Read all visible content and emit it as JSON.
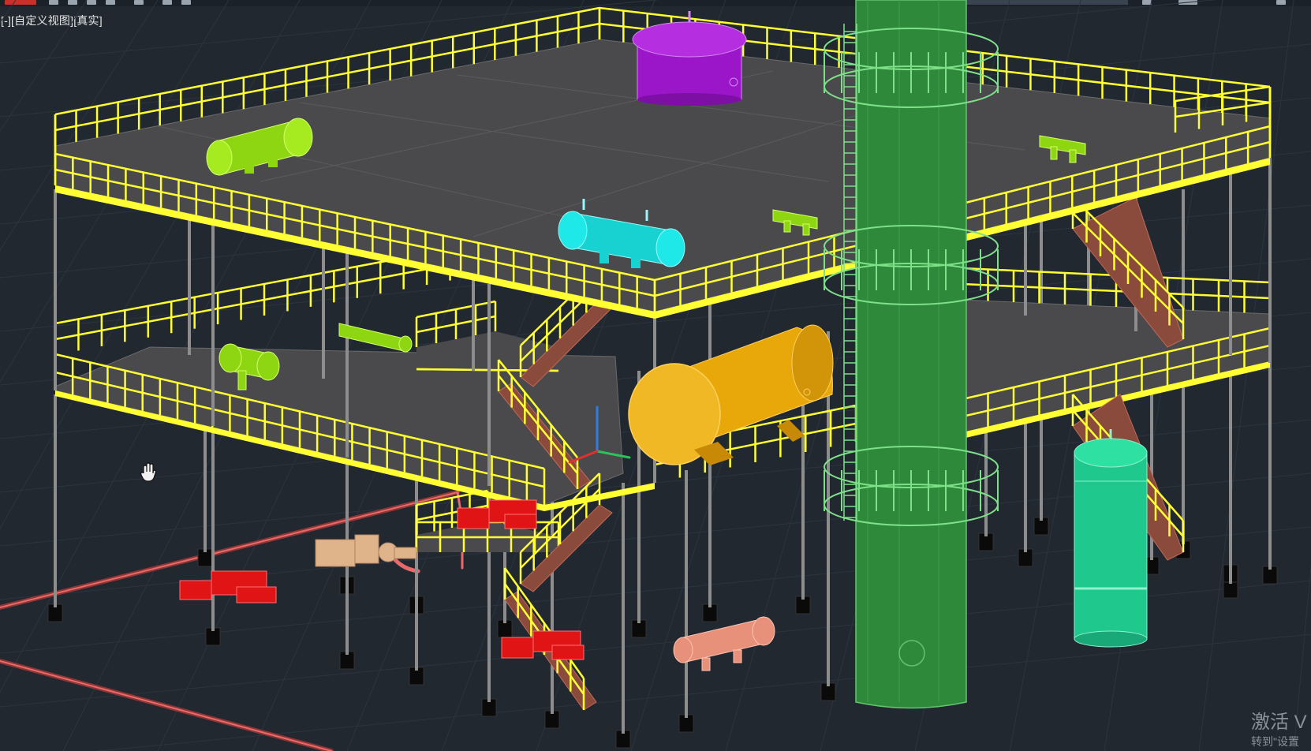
{
  "viewport": {
    "control_label": "[-]",
    "view_label": "[自定义视图]",
    "style_label": "[真实]"
  },
  "watermark": {
    "line1": "激活 V",
    "line2": "转到\"设置"
  },
  "colors": {
    "background": "#212830",
    "grid": "#2c3440",
    "deck": "#4a4a4c",
    "railing": "#ffff33",
    "column": "#8d8d8d",
    "stair": "#8a4a3c",
    "tower": "#2e8a3a",
    "vessel_purple": "#9b16c9",
    "vessel_orange": "#e9a80a",
    "vessel_teal": "#1fc98e",
    "exchanger_lime": "#8fd612",
    "exchanger_cyan": "#18d2d2",
    "exchanger_salmon": "#e8917a",
    "pump_red": "#e01414",
    "pipe": "#e86a6a"
  },
  "icons": {
    "pan_cursor": "hand-pan-icon",
    "ucs": "ucs-axis-icon"
  }
}
